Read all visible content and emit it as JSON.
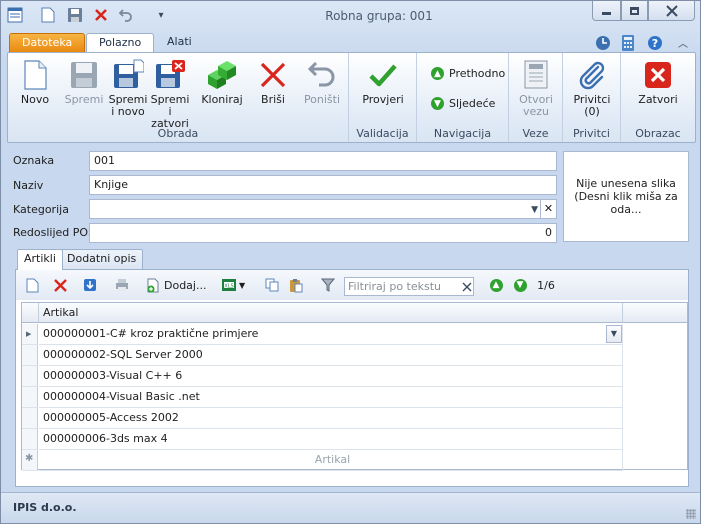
{
  "window": {
    "title": "Robna grupa: 001"
  },
  "ribbon_tabs": [
    "Datoteka",
    "Polazno",
    "Alati"
  ],
  "ribbon": {
    "groups": {
      "obrada": "Obrada",
      "validacija": "Validacija",
      "navigacija": "Navigacija",
      "veze": "Veze",
      "privitci": "Privitci",
      "obrazac": "Obrazac"
    },
    "buttons": {
      "novo": "Novo",
      "spremi": "Spremi",
      "spremi_novo_1": "Spremi",
      "spremi_novo_2": "i novo",
      "spremi_zatvori_1": "Spremi i",
      "spremi_zatvori_2": "zatvori",
      "kloniraj": "Kloniraj",
      "brisi": "Briši",
      "ponisti": "Poništi",
      "provjeri": "Provjeri",
      "prethodno": "Prethodno",
      "sljedece": "Sljedeće",
      "otvori_veze_1": "Otvori",
      "otvori_veze_2": "vezu",
      "privitci_1": "Privitci",
      "privitci_2": "(0)",
      "zatvori": "Zatvori"
    }
  },
  "form": {
    "oznaka": {
      "label": "Oznaka",
      "value": "001"
    },
    "naziv": {
      "label": "Naziv",
      "value": "Knjige"
    },
    "kategorija": {
      "label": "Kategorija",
      "value": ""
    },
    "redoslijed": {
      "label": "Redoslijed POS",
      "value": "0"
    },
    "picture_line1": "Nije unesena slika",
    "picture_line2": "(Desni klik miša za oda..."
  },
  "inner_tabs": [
    "Artikli",
    "Dodatni opis"
  ],
  "grid_toolbar": {
    "dodaj": "Dodaj...",
    "filter_placeholder": "Filtriraj po tekstu",
    "page": "1/6"
  },
  "grid": {
    "column": "Artikal",
    "rows": [
      "000000001-C# kroz praktične primjere",
      "000000002-SQL Server 2000",
      "000000003-Visual C++ 6",
      "000000004-Visual Basic .net",
      "000000005-Access 2002",
      "000000006-3ds max 4"
    ],
    "new_row_placeholder": "Artikal"
  },
  "status": {
    "company": "IPIS d.o.o."
  },
  "colors": {
    "accent_orange": "#e8870d",
    "ribbon_blue": "#c8d8ee",
    "green": "#2fa12f",
    "red": "#d9261c"
  }
}
